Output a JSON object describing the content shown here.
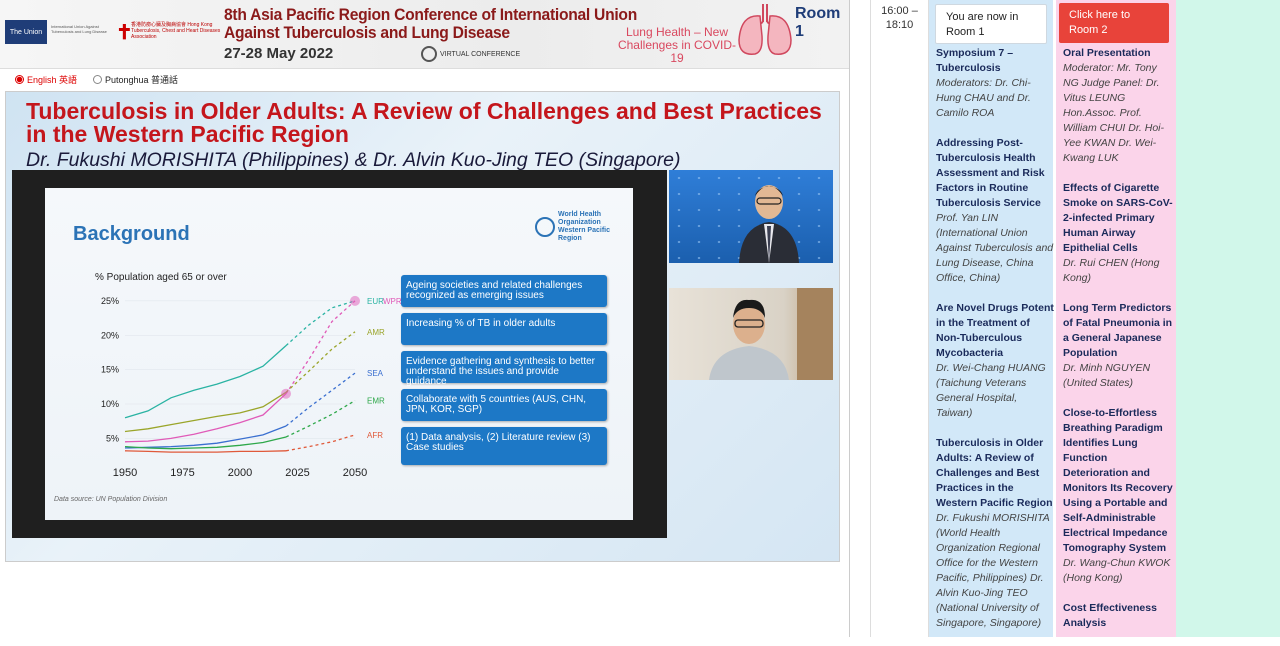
{
  "banner": {
    "union_logo": "The Union",
    "union_sub": "International Union Against Tuberculosis and Lung Disease",
    "hk_name": "香港防癆心臟及胸病協會 Hong Kong Tuberculosis, Chest and Heart Diseases Association",
    "title_line1": "8th Asia Pacific Region Conference of International Union",
    "title_line2": "Against Tuberculosis and Lung Disease",
    "dates": "27-28 May 2022",
    "virtual": "VIRTUAL CONFERENCE",
    "tagline": "Lung Health – New Challenges in COVID-19",
    "room": "Room 1"
  },
  "languages": [
    {
      "label": "English 英語",
      "selected": true
    },
    {
      "label": "Putonghua 普通話",
      "selected": false
    }
  ],
  "talk": {
    "title": "Tuberculosis in Older Adults: A Review of Challenges and Best Practices in the Western Pacific Region",
    "speakers": "Dr. Fukushi MORISHITA (Philippines) & Dr. Alvin Kuo-Jing TEO (Singapore)"
  },
  "slide": {
    "heading": "Background",
    "who_label": "World Health Organization Western Pacific Region",
    "data_source": "Data source: UN Population Division",
    "boxes": [
      "Ageing societies and related challenges recognized as emerging issues",
      "Increasing % of TB in older adults",
      "Evidence gathering and synthesis to better understand the issues and provide guidance",
      "Collaborate with 5 countries (AUS, CHN, JPN, KOR, SGP)",
      "(1) Data analysis, (2) Literature review (3) Case studies"
    ]
  },
  "chart_data": {
    "type": "line",
    "title": "% Population aged 65 or over",
    "xlabel": "",
    "ylabel": "",
    "x_ticks": [
      1950,
      1975,
      2000,
      2025,
      2050
    ],
    "y_ticks": [
      "5%",
      "10%",
      "15%",
      "20%",
      "25%"
    ],
    "xlim": [
      1950,
      2050
    ],
    "ylim": [
      2,
      26
    ],
    "series": [
      {
        "name": "EUR",
        "color": "#2ab3a3",
        "x": [
          1950,
          1960,
          1970,
          1980,
          1990,
          2000,
          2010,
          2020,
          2030,
          2040,
          2050
        ],
        "y": [
          8.0,
          9.0,
          10.9,
          12.0,
          12.9,
          14.0,
          15.5,
          18.5,
          21.5,
          24.0,
          25.0
        ]
      },
      {
        "name": "WPR",
        "color": "#e05ab8",
        "x": [
          1950,
          1960,
          1970,
          1980,
          1990,
          2000,
          2010,
          2020,
          2030,
          2040,
          2050
        ],
        "y": [
          4.5,
          4.6,
          5.0,
          5.6,
          6.4,
          7.3,
          8.4,
          11.5,
          16.5,
          22.0,
          25.0
        ]
      },
      {
        "name": "AMR",
        "color": "#9aa52a",
        "x": [
          1950,
          1960,
          1970,
          1980,
          1990,
          2000,
          2010,
          2020,
          2030,
          2040,
          2050
        ],
        "y": [
          6.0,
          6.4,
          7.0,
          7.6,
          8.2,
          8.7,
          9.6,
          11.7,
          14.8,
          18.0,
          20.5
        ]
      },
      {
        "name": "SEA",
        "color": "#3a6fd0",
        "x": [
          1950,
          1960,
          1970,
          1980,
          1990,
          2000,
          2010,
          2020,
          2030,
          2040,
          2050
        ],
        "y": [
          3.6,
          3.7,
          3.8,
          4.0,
          4.3,
          4.9,
          5.5,
          6.8,
          9.5,
          12.0,
          14.5
        ]
      },
      {
        "name": "EMR",
        "color": "#2ea84a",
        "x": [
          1950,
          1960,
          1970,
          1980,
          1990,
          2000,
          2010,
          2020,
          2030,
          2040,
          2050
        ],
        "y": [
          3.8,
          3.6,
          3.5,
          3.6,
          3.7,
          4.0,
          4.4,
          5.2,
          6.8,
          8.5,
          10.5
        ]
      },
      {
        "name": "AFR",
        "color": "#e0593a",
        "x": [
          1950,
          1960,
          1970,
          1980,
          1990,
          2000,
          2010,
          2020,
          2030,
          2040,
          2050
        ],
        "y": [
          3.2,
          3.1,
          3.0,
          3.0,
          3.0,
          3.1,
          3.1,
          3.2,
          3.8,
          4.5,
          5.5
        ]
      }
    ]
  },
  "schedule": {
    "time": "16:00 – 18:10",
    "room1_notice": "You are now in Room 1",
    "room2_link": "Click here to Room 2",
    "room1_items": [
      {
        "title": "Symposium 7 – Tuberculosis",
        "meta": "Moderators: Dr. Chi-Hung CHAU and Dr. Camilo ROA"
      },
      {
        "title": "Addressing Post-Tuberculosis Health Assessment and Risk Factors in Routine Tuberculosis Service",
        "meta": "Prof. Yan LIN (International Union Against Tuberculosis and Lung Disease, China Office, China)"
      },
      {
        "title": "Are Novel Drugs Potent in the Treatment of Non-Tuberculous Mycobacteria",
        "meta": "Dr. Wei-Chang HUANG (Taichung Veterans General Hospital, Taiwan)"
      },
      {
        "title": "Tuberculosis in Older Adults: A Review of Challenges and Best Practices in the Western Pacific Region",
        "meta": "Dr. Fukushi MORISHITA (World Health Organization Regional Office for the Western Pacific, Philippines) Dr. Alvin Kuo-Jing TEO (National University of Singapore, Singapore)"
      }
    ],
    "room2_items": [
      {
        "title": "Oral Presentation",
        "meta": "Moderator: Mr. Tony NG Judge Panel: Dr. Vitus LEUNG Hon.Assoc. Prof. William CHUI Dr. Hoi-Yee KWAN Dr. Wei-Kwang LUK"
      },
      {
        "title": "Effects of Cigarette Smoke on SARS-CoV-2-infected Primary Human Airway Epithelial Cells",
        "meta": "Dr. Rui CHEN (Hong Kong)"
      },
      {
        "title": "Long Term Predictors of Fatal Pneumonia in a General Japanese Population",
        "meta": "Dr. Minh NGUYEN (United States)"
      },
      {
        "title": "Close-to-Effortless Breathing Paradigm Identifies Lung Function Deterioration and Monitors Its Recovery Using a Portable and Self-Administrable Electrical Impedance Tomography System",
        "meta": "Dr. Wang-Chun KWOK (Hong Kong)"
      },
      {
        "title": "Cost Effectiveness Analysis",
        "meta": ""
      }
    ]
  }
}
